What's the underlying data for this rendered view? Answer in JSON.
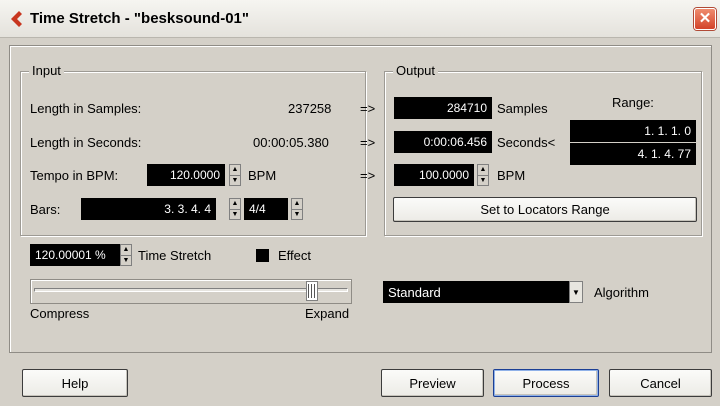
{
  "window": {
    "title": "Time Stretch - \"besksound-01\"",
    "close_glyph": "✕"
  },
  "input": {
    "legend": "Input",
    "length_samples_label": "Length in Samples:",
    "length_samples_value": "237258",
    "length_seconds_label": "Length in Seconds:",
    "length_seconds_value": "00:00:05.380",
    "tempo_label": "Tempo in BPM:",
    "tempo_value": "120.0000",
    "tempo_unit": "BPM",
    "bars_label": "Bars:",
    "bars_value": "3. 3. 4.   4",
    "signature_value": "4/4"
  },
  "arrows": [
    "=>",
    "=>",
    "=>"
  ],
  "output": {
    "legend": "Output",
    "samples_value": "284710",
    "samples_unit": "Samples",
    "seconds_value": "0:00:06.456",
    "seconds_unit": "Seconds<",
    "bpm_value": "100.0000",
    "bpm_unit": "BPM",
    "range_label": "Range:",
    "range_start": "1. 1. 1.   0",
    "range_end": "4. 1. 4. 77",
    "set_locators_label": "Set to Locators Range"
  },
  "stretch": {
    "value": "120.00001 %",
    "label": "Time Stretch",
    "effect_label": "Effect",
    "effect_checked": true,
    "slider_position": 0.9,
    "compress_label": "Compress",
    "expand_label": "Expand"
  },
  "algorithm": {
    "selected": "Standard",
    "label": "Algorithm"
  },
  "buttons": {
    "help": "Help",
    "preview": "Preview",
    "process": "Process",
    "cancel": "Cancel"
  },
  "icons": {
    "title_logo": "cubase-logo-icon",
    "close": "close-icon",
    "spin": "spinner-arrows-icon",
    "dropdown": "chevron-down-icon"
  },
  "colors": {
    "dialog_bg": "#d4d0c8",
    "field_bg": "#000000",
    "field_text": "#ffffff",
    "close_button": "#d3432a",
    "logo": "#c8361f"
  }
}
